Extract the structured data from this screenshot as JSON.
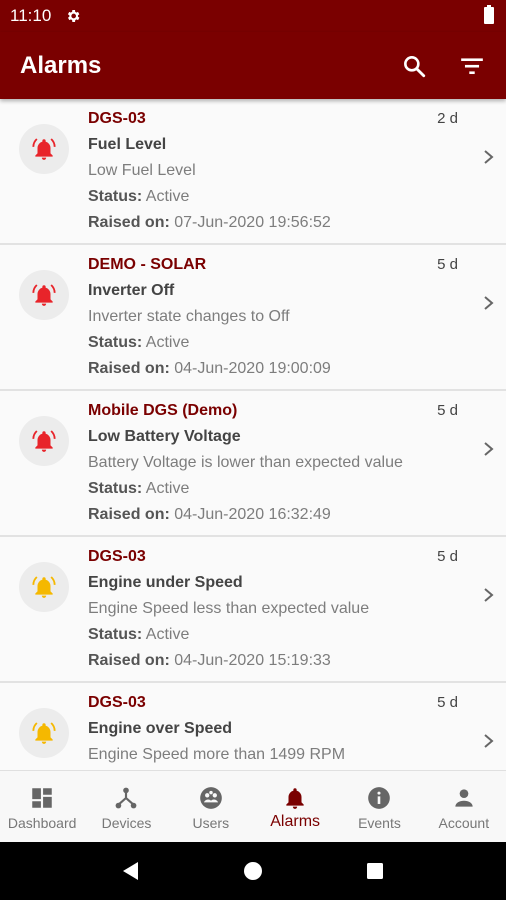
{
  "status_bar": {
    "time": "11:10"
  },
  "app_bar": {
    "title": "Alarms"
  },
  "labels": {
    "status": "Status:",
    "raised": "Raised on:"
  },
  "alarms": [
    {
      "source": "DGS-03",
      "age": "2 d",
      "title": "Fuel Level",
      "desc": "Low Fuel Level",
      "status": "Active",
      "raised": "07-Jun-2020 19:56:52",
      "severity_color": "#e8242a"
    },
    {
      "source": "DEMO - SOLAR",
      "age": "5 d",
      "title": "Inverter Off",
      "desc": "Inverter state changes to Off",
      "status": "Active",
      "raised": "04-Jun-2020 19:00:09",
      "severity_color": "#e8242a"
    },
    {
      "source": "Mobile DGS (Demo)",
      "age": "5 d",
      "title": "Low Battery Voltage",
      "desc": "Battery Voltage is lower than expected value",
      "status": "Active",
      "raised": "04-Jun-2020 16:32:49",
      "severity_color": "#e8242a"
    },
    {
      "source": "DGS-03",
      "age": "5 d",
      "title": "Engine under Speed",
      "desc": "Engine Speed less than expected value",
      "status": "Active",
      "raised": "04-Jun-2020 15:19:33",
      "severity_color": "#f5b800"
    },
    {
      "source": "DGS-03",
      "age": "5 d",
      "title": "Engine over Speed",
      "desc": "Engine Speed more than 1499 RPM",
      "status": "",
      "raised": "",
      "severity_color": "#f5b800"
    }
  ],
  "bottom_nav": [
    {
      "label": "Dashboard",
      "icon": "dashboard-icon"
    },
    {
      "label": "Devices",
      "icon": "devices-icon"
    },
    {
      "label": "Users",
      "icon": "users-icon"
    },
    {
      "label": "Alarms",
      "icon": "bell-icon",
      "active": true
    },
    {
      "label": "Events",
      "icon": "info-icon"
    },
    {
      "label": "Account",
      "icon": "account-icon"
    }
  ],
  "colors": {
    "brand": "#7a0000",
    "critical": "#e8242a",
    "warning": "#f5b800"
  }
}
